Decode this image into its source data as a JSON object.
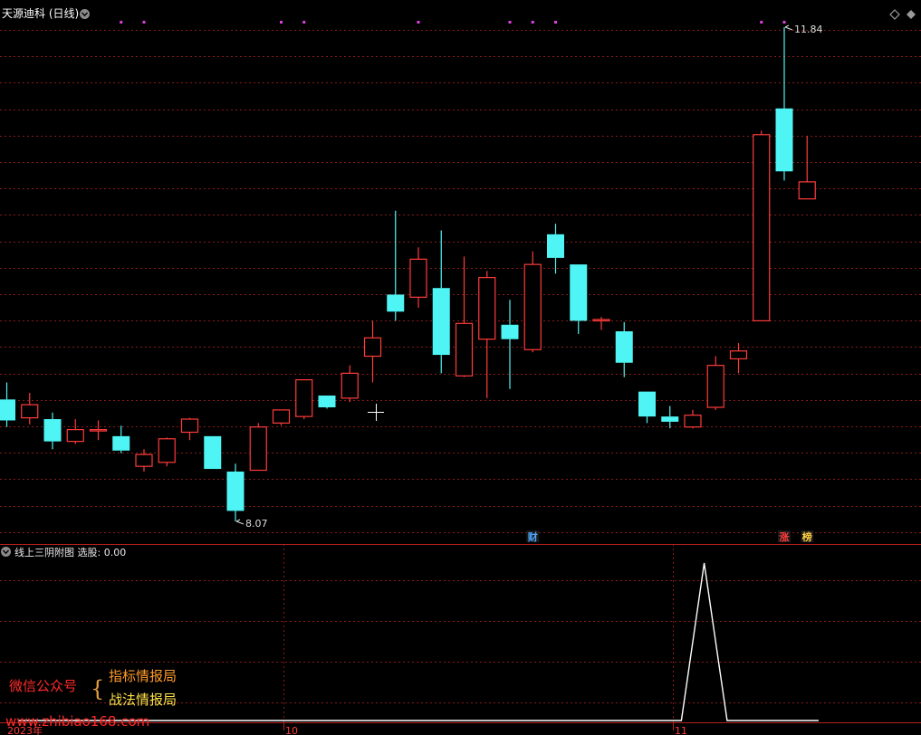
{
  "main_panel": {
    "title": "天源迪科 (日线)"
  },
  "indicator_panel": {
    "name": "线上三阴附图",
    "field_label": "选股: ",
    "value": "0.00"
  },
  "time_axis": [
    "2023年",
    "10",
    "11"
  ],
  "watermark": {
    "wechat_label": "微信公众号",
    "brace": "{",
    "name_1": "指标情报局",
    "name_2": "战法情报局",
    "url": "www.zhibiao168.com"
  },
  "colors": {
    "up": "#ff3b3b",
    "down": "#4ff5f5",
    "signal_dot": "#e040e0",
    "indicator_line": "#ffffff",
    "grid": "#8a1a1a",
    "marker_cai": "#4fa8ff",
    "marker_zhang": "#ff3b3b",
    "marker_bang": "#ffd040"
  },
  "chart_data": {
    "type": "candlestick",
    "title": "天源迪科 (日线)",
    "price_axis_range": [
      7.9,
      12.0
    ],
    "candles": [
      {
        "open": 9.0,
        "high": 9.13,
        "low": 8.79,
        "close": 8.84
      },
      {
        "open": 8.86,
        "high": 9.05,
        "low": 8.81,
        "close": 8.96
      },
      {
        "open": 8.85,
        "high": 8.9,
        "low": 8.62,
        "close": 8.68
      },
      {
        "open": 8.68,
        "high": 8.85,
        "low": 8.66,
        "close": 8.77
      },
      {
        "open": 8.76,
        "high": 8.84,
        "low": 8.69,
        "close": 8.77
      },
      {
        "open": 8.72,
        "high": 8.8,
        "low": 8.59,
        "close": 8.61
      },
      {
        "open": 8.49,
        "high": 8.62,
        "low": 8.45,
        "close": 8.58
      },
      {
        "open": 8.52,
        "high": 8.71,
        "low": 8.49,
        "close": 8.7
      },
      {
        "open": 8.75,
        "high": 8.86,
        "low": 8.69,
        "close": 8.85
      },
      {
        "open": 8.72,
        "high": 8.72,
        "low": 8.47,
        "close": 8.47
      },
      {
        "open": 8.45,
        "high": 8.51,
        "low": 8.07,
        "close": 8.15
      },
      {
        "open": 8.46,
        "high": 8.82,
        "low": 8.46,
        "close": 8.79
      },
      {
        "open": 8.82,
        "high": 8.92,
        "low": 8.8,
        "close": 8.92
      },
      {
        "open": 8.87,
        "high": 9.15,
        "low": 8.85,
        "close": 9.15
      },
      {
        "open": 9.03,
        "high": 9.03,
        "low": 8.93,
        "close": 8.94
      },
      {
        "open": 9.01,
        "high": 9.26,
        "low": 8.98,
        "close": 9.2
      },
      {
        "open": 9.33,
        "high": 9.6,
        "low": 9.13,
        "close": 9.47
      },
      {
        "open": 9.8,
        "high": 10.44,
        "low": 9.6,
        "close": 9.67
      },
      {
        "open": 9.78,
        "high": 10.16,
        "low": 9.7,
        "close": 10.07
      },
      {
        "open": 9.85,
        "high": 10.29,
        "low": 9.2,
        "close": 9.34
      },
      {
        "open": 9.18,
        "high": 10.09,
        "low": 9.17,
        "close": 9.58
      },
      {
        "open": 9.46,
        "high": 9.98,
        "low": 9.01,
        "close": 9.93
      },
      {
        "open": 9.57,
        "high": 9.76,
        "low": 9.08,
        "close": 9.46
      },
      {
        "open": 9.38,
        "high": 10.13,
        "low": 9.36,
        "close": 10.03
      },
      {
        "open": 10.26,
        "high": 10.34,
        "low": 9.96,
        "close": 10.08
      },
      {
        "open": 10.03,
        "high": 10.03,
        "low": 9.5,
        "close": 9.6
      },
      {
        "open": 9.61,
        "high": 9.63,
        "low": 9.53,
        "close": 9.61
      },
      {
        "open": 9.52,
        "high": 9.59,
        "low": 9.17,
        "close": 9.28
      },
      {
        "open": 9.06,
        "high": 9.06,
        "low": 8.82,
        "close": 8.87
      },
      {
        "open": 8.87,
        "high": 8.95,
        "low": 8.78,
        "close": 8.83
      },
      {
        "open": 8.79,
        "high": 8.92,
        "low": 8.78,
        "close": 8.88
      },
      {
        "open": 8.94,
        "high": 9.33,
        "low": 8.92,
        "close": 9.26
      },
      {
        "open": 9.31,
        "high": 9.43,
        "low": 9.2,
        "close": 9.37
      },
      {
        "open": 9.6,
        "high": 11.05,
        "low": 9.6,
        "close": 11.02
      },
      {
        "open": 11.22,
        "high": 11.84,
        "low": 10.67,
        "close": 10.74
      },
      {
        "open": 10.53,
        "high": 11.01,
        "low": 10.53,
        "close": 10.66
      }
    ],
    "annotations": [
      {
        "candle_index": 10,
        "text": "8.07",
        "kind": "low"
      },
      {
        "candle_index": 34,
        "text": "11.84",
        "kind": "high"
      }
    ],
    "event_markers": [
      {
        "candle_index": 23,
        "text": "财"
      },
      {
        "candle_index": 34,
        "text": "涨"
      },
      {
        "candle_index": 35,
        "text": "榜"
      }
    ],
    "signal_dots_candle_indices": [
      5,
      6,
      12,
      13,
      18,
      22,
      23,
      24,
      33,
      34
    ],
    "indicator": {
      "name": "线上三阴附图",
      "field": "选股",
      "current_value": 0.0,
      "values": [
        0,
        0,
        0,
        0,
        0,
        0,
        0,
        0,
        0,
        0,
        0,
        0,
        0,
        0,
        0,
        0,
        0,
        0,
        0,
        0,
        0,
        0,
        0,
        0,
        0,
        0,
        0,
        0,
        0,
        0,
        1,
        0,
        0,
        0,
        0,
        0
      ],
      "y_range": [
        0,
        1
      ]
    }
  }
}
